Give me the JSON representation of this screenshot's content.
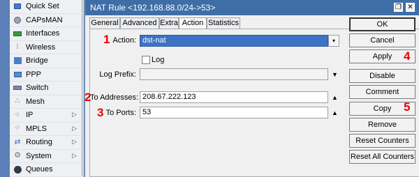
{
  "menu": {
    "items": [
      {
        "label": "Quick Set",
        "icon": "quick-set-icon",
        "has_submenu": false
      },
      {
        "label": "CAPsMAN",
        "icon": "capsman-icon",
        "has_submenu": false
      },
      {
        "label": "Interfaces",
        "icon": "interfaces-icon",
        "has_submenu": false
      },
      {
        "label": "Wireless",
        "icon": "wireless-icon",
        "has_submenu": false
      },
      {
        "label": "Bridge",
        "icon": "bridge-icon",
        "has_submenu": false
      },
      {
        "label": "PPP",
        "icon": "ppp-icon",
        "has_submenu": false
      },
      {
        "label": "Switch",
        "icon": "switch-icon",
        "has_submenu": false
      },
      {
        "label": "Mesh",
        "icon": "mesh-icon",
        "has_submenu": false
      },
      {
        "label": "IP",
        "icon": "ip-icon",
        "has_submenu": true
      },
      {
        "label": "MPLS",
        "icon": "mpls-icon",
        "has_submenu": true
      },
      {
        "label": "Routing",
        "icon": "routing-icon",
        "has_submenu": true
      },
      {
        "label": "System",
        "icon": "system-icon",
        "has_submenu": true
      },
      {
        "label": "Queues",
        "icon": "queues-icon",
        "has_submenu": false
      }
    ]
  },
  "dialog": {
    "title": "NAT Rule <192.168.88.0/24->53>",
    "restore_glyph": "❐",
    "close_glyph": "✕",
    "tabs": [
      "General",
      "Advanced",
      "Extra",
      "Action",
      "Statistics"
    ],
    "active_tab": "Action",
    "fields": {
      "action_label": "Action:",
      "action_value": "dst-nat",
      "log_label": "Log",
      "log_checked": false,
      "log_prefix_label": "Log Prefix:",
      "log_prefix_value": "",
      "to_addresses_label": "To Addresses:",
      "to_addresses_value": "208.67.222.123",
      "to_ports_label": "To Ports:",
      "to_ports_value": "53"
    },
    "buttons": [
      "OK",
      "Cancel",
      "Apply",
      "Disable",
      "Comment",
      "Copy",
      "Remove",
      "Reset Counters",
      "Reset All Counters"
    ]
  },
  "annotations": [
    "1",
    "2",
    "3",
    "4",
    "5"
  ],
  "colors": {
    "title_bar": "#3f6ea6",
    "selection": "#3d73c6",
    "annotation": "#e60000"
  }
}
